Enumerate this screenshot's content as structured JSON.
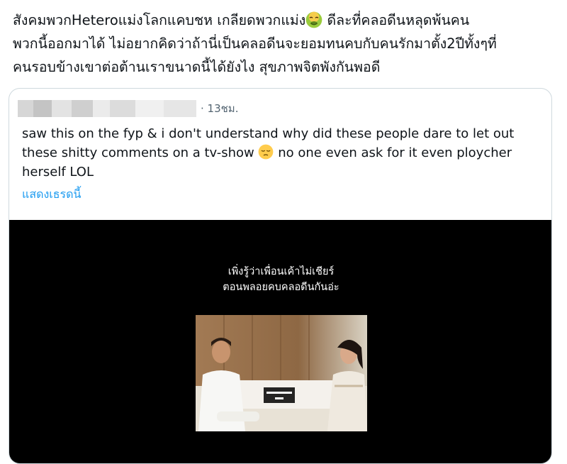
{
  "post": {
    "text_line1": "สังคมพวกHeteroแม่งโลกแคบชห เกลียดพวกแม่ง",
    "text_line1_after": " ดีละที่คลอดีนหลุดพ้นคน",
    "text_line2": "พวกนี้ออกมาได้ ไม่อยากคิดว่าถ้านี่เป็นคลอดีนจะยอมทนคบกับคนรักมาตั้ง2ปีทั้งๆที่",
    "text_line3": "คนรอบข้างเขาต่อต้านเราขนาดนี้ได้ยังไง สุขภาพจิตพังกันพอดี",
    "emoji": "nauseated-face-icon"
  },
  "quoted_post": {
    "time": "· 13ชม.",
    "text": "saw this on the fyp & i don't understand why did these people dare to let out these shitty comments on a tv-show",
    "text_after": " no one even ask for it even ploycher herself LOL",
    "emoji": "pensive-face-icon",
    "show_thread": "แสดงเธรดนี้",
    "video": {
      "caption_line1": "เพิ่งรู้ว่าเพื่อนเค้าไม่เชียร์",
      "caption_line2": "ตอนพลอยคบคลอดีนกันอ่ะ"
    }
  },
  "colors": {
    "link": "#1d9bf0",
    "secondary_text": "#536471",
    "border": "#cfd9de"
  }
}
